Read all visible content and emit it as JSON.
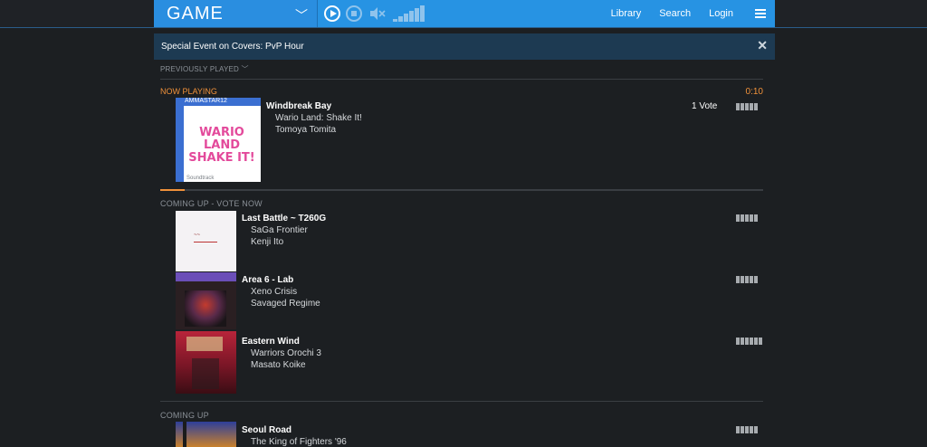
{
  "header": {
    "brand": "GAME",
    "nav": [
      "Library",
      "Search",
      "Login"
    ],
    "volume_level": 0.8
  },
  "banner": {
    "text": "Special Event on Covers: PvP Hour"
  },
  "previously_played": "PREVIOUSLY PLAYED",
  "now_playing": {
    "label": "NOW PLAYING",
    "elapsed": "0:10",
    "title": "Windbreak Bay",
    "game": "Wario Land: Shake It!",
    "artist": "Tomoya Tomita",
    "votes": "1 Vote",
    "cover_art_text": "AMMASTAR12",
    "cover_logo": "WARIO LAND SHAKE IT!",
    "cover_footer": "Soundtrack",
    "progress": 0.04
  },
  "coming_up_vote": {
    "label": "COMING UP - VOTE NOW",
    "tracks": [
      {
        "title": "Last Battle ~ T260G",
        "game": "SaGa Frontier",
        "artist": "Kenji Ito"
      },
      {
        "title": "Area 6 - Lab",
        "game": "Xeno Crisis",
        "artist": "Savaged Regime"
      },
      {
        "title": "Eastern Wind",
        "game": "Warriors Orochi 3",
        "artist": "Masato Koike"
      }
    ]
  },
  "coming_up": {
    "label": "COMING UP",
    "tracks": [
      {
        "title": "Seoul Road",
        "game": "The King of Fighters '96"
      }
    ]
  },
  "colors": {
    "accent": "#2793e3",
    "orange": "#f0913a",
    "background": "#1c1f22",
    "banner": "#1d3a52"
  }
}
